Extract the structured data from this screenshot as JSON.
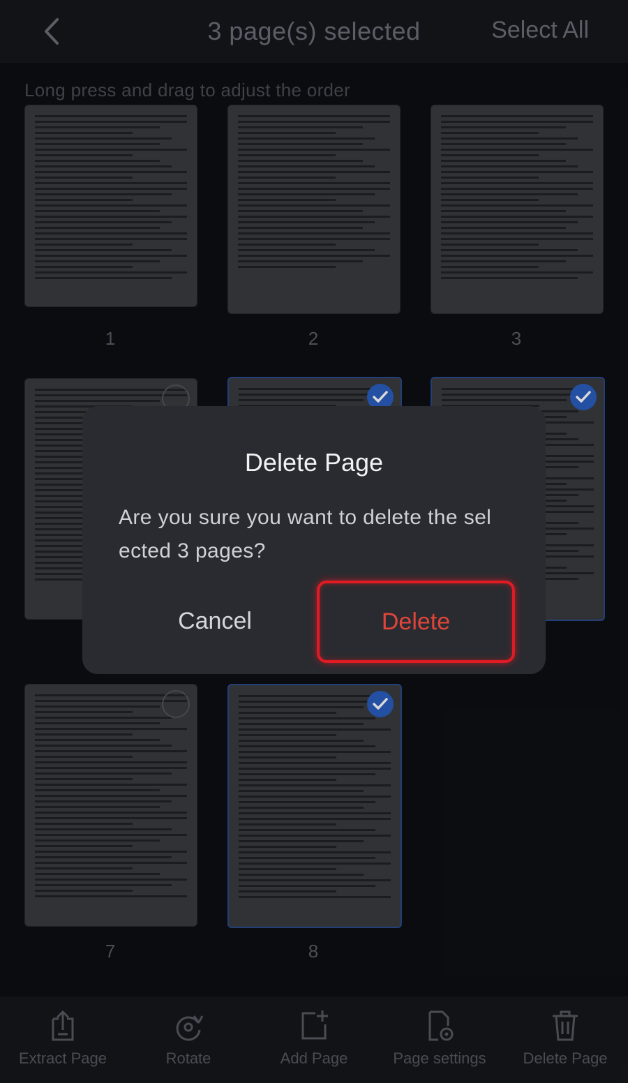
{
  "header": {
    "title": "3 page(s) selected",
    "select_all": "Select All"
  },
  "hint": "Long press and drag to adjust the order",
  "pages": [
    {
      "number": "1",
      "selected": false
    },
    {
      "number": "2",
      "selected": false
    },
    {
      "number": "3",
      "selected": false
    },
    {
      "number": "",
      "selected": false
    },
    {
      "number": "",
      "selected": true
    },
    {
      "number": "",
      "selected": true
    },
    {
      "number": "7",
      "selected": false
    },
    {
      "number": "8",
      "selected": true
    }
  ],
  "dialog": {
    "title": "Delete Page",
    "message": "Are you sure you want to delete the sel ected 3 pages?",
    "cancel": "Cancel",
    "delete": "Delete"
  },
  "toolbar": {
    "extract": "Extract Page",
    "rotate": "Rotate",
    "add": "Add Page",
    "settings": "Page settings",
    "delete": "Delete Page"
  },
  "colors": {
    "accent_blue": "#2a5ec0",
    "delete_red": "#e0453a"
  }
}
